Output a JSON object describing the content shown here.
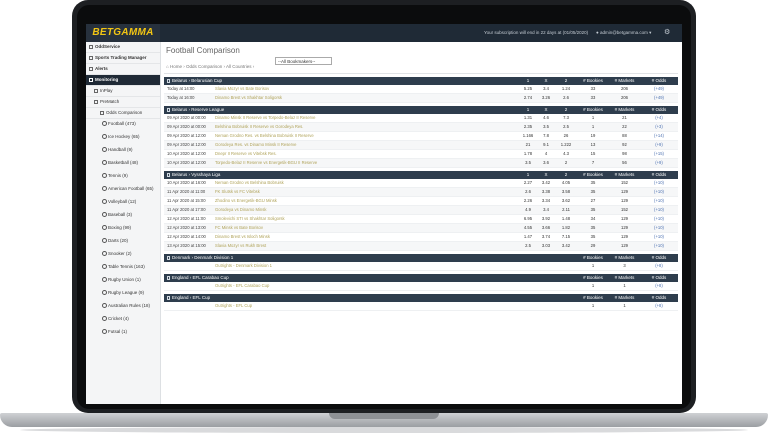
{
  "app": {
    "logo": "BETGAMMA",
    "subscription_note": "Your subscription will end in 22 days at (01/05/2020)",
    "user_email": "admin@betgamma.com"
  },
  "sidebar": {
    "items": [
      {
        "label": "OddService"
      },
      {
        "label": "Sports Trading Manager"
      },
      {
        "label": "Alerts"
      },
      {
        "label": "Monitoring"
      },
      {
        "label": "InPlay"
      },
      {
        "label": "PreMatch"
      },
      {
        "label": "Odds Comparison"
      }
    ],
    "sports": [
      {
        "label": "Football (473)"
      },
      {
        "label": "Ice Hockey (65)"
      },
      {
        "label": "Handball (9)"
      },
      {
        "label": "Basketball (48)"
      },
      {
        "label": "Tennis (9)"
      },
      {
        "label": "American Football (65)"
      },
      {
        "label": "Volleyball (12)"
      },
      {
        "label": "Baseball (3)"
      },
      {
        "label": "Boxing (99)"
      },
      {
        "label": "Darts (20)"
      },
      {
        "label": "Snooker (2)"
      },
      {
        "label": "Table Tennis (163)"
      },
      {
        "label": "Rugby Union (1)"
      },
      {
        "label": "Rugby League (9)"
      },
      {
        "label": "Australian Rules (18)"
      },
      {
        "label": "Cricket (4)"
      },
      {
        "label": "Futsal (1)"
      }
    ]
  },
  "page": {
    "title": "Football Comparison",
    "breadcrumb": "Home  ›  Odds Comparison  ›  All Countries  ›",
    "bookmaker_select": "--All Bookmakers--"
  },
  "columns": {
    "c1": "1",
    "cx": "X",
    "c2": "2",
    "bookies": "# Bookies",
    "markets": "# Markets",
    "odds": "# Odds"
  },
  "sections": [
    {
      "title": "Belarus › Belarusian Cup",
      "show_123": true,
      "rows": [
        {
          "date": "Today at 14:00",
          "match": "Slavia Mozyr vs Bate Borisov",
          "o1": "5.25",
          "ox": "3.4",
          "o2": "1.24",
          "bookies": "33",
          "markets": "206",
          "odds": "(+49)"
        },
        {
          "date": "Today at 16:00",
          "match": "Dinamo Brest vs Shakhtar Soligorsk",
          "o1": "2.74",
          "ox": "3.26",
          "o2": "2.6",
          "bookies": "33",
          "markets": "206",
          "odds": "(+49)"
        }
      ]
    },
    {
      "title": "Belarus › Reserve League",
      "show_123": true,
      "rows": [
        {
          "date": "09 Apr 2020 at 00:00",
          "match": "Dinamo Minsk II Reserve vs Torpedo-Belaz II Reserve",
          "o1": "1.31",
          "ox": "4.6",
          "o2": "7.3",
          "bookies": "1",
          "markets": "21",
          "odds": "(+4)"
        },
        {
          "date": "09 Apr 2020 at 00:00",
          "match": "Belshina Bobruisk II Reserve vs Gorodeya Res.",
          "o1": "2.35",
          "ox": "3.5",
          "o2": "2.5",
          "bookies": "1",
          "markets": "22",
          "odds": "(+3)"
        },
        {
          "date": "09 Apr 2020 at 12:00",
          "match": "Neman Grodno Res. vs Belshina Bobruisk II Reserve",
          "o1": "1.166",
          "ox": "7.8",
          "o2": "26",
          "bookies": "19",
          "markets": "88",
          "odds": "(+14)"
        },
        {
          "date": "09 Apr 2020 at 12:00",
          "match": "Gorodeya Res. vs Dinamo Minsk II Reserve",
          "o1": "21",
          "ox": "9.1",
          "o2": "1.222",
          "bookies": "13",
          "markets": "92",
          "odds": "(+9)"
        },
        {
          "date": "10 Apr 2020 at 12:00",
          "match": "Dnepr II Reserve vs Vitebsk Res.",
          "o1": "1.78",
          "ox": "4",
          "o2": "4.3",
          "bookies": "15",
          "markets": "98",
          "odds": "(+15)"
        },
        {
          "date": "10 Apr 2020 at 12:00",
          "match": "Torpedo-Belaz II Reserve vs Energetik-BGU II Reserve",
          "o1": "3.5",
          "ox": "3.6",
          "o2": "2",
          "bookies": "7",
          "markets": "56",
          "odds": "(+9)"
        }
      ]
    },
    {
      "title": "Belarus › Vysshaya Liga",
      "show_123": true,
      "rows": [
        {
          "date": "10 Apr 2020 at 16:00",
          "match": "Neman Grodno vs Belshina Bobruisk",
          "o1": "2.27",
          "ox": "3.42",
          "o2": "4.05",
          "bookies": "35",
          "markets": "152",
          "odds": "(+10)"
        },
        {
          "date": "11 Apr 2020 at 11:00",
          "match": "FK Slutsk vs FC Vitebsk",
          "o1": "2.6",
          "ox": "3.38",
          "o2": "3.58",
          "bookies": "35",
          "markets": "129",
          "odds": "(+10)"
        },
        {
          "date": "11 Apr 2020 at 15:00",
          "match": "Zhodino vs Energetik-BGU Minsk",
          "o1": "2.26",
          "ox": "3.34",
          "o2": "3.62",
          "bookies": "27",
          "markets": "129",
          "odds": "(+10)"
        },
        {
          "date": "11 Apr 2020 at 17:00",
          "match": "Gorodeya vs Dinamo Minsk",
          "o1": "4.9",
          "ox": "3.4",
          "o2": "2.11",
          "bookies": "35",
          "markets": "152",
          "odds": "(+10)"
        },
        {
          "date": "12 Apr 2020 at 11:00",
          "match": "Smolevichi STI vs Shakhtar Soligorsk",
          "o1": "6.95",
          "ox": "3.92",
          "o2": "1.48",
          "bookies": "34",
          "markets": "129",
          "odds": "(+10)"
        },
        {
          "date": "12 Apr 2020 at 13:00",
          "match": "FC Minsk vs Bate Borisov",
          "o1": "4.55",
          "ox": "3.66",
          "o2": "1.82",
          "bookies": "35",
          "markets": "129",
          "odds": "(+10)"
        },
        {
          "date": "12 Apr 2020 at 14:00",
          "match": "Dinamo Brest vs Isloch Minsk",
          "o1": "1.47",
          "ox": "3.74",
          "o2": "7.15",
          "bookies": "35",
          "markets": "129",
          "odds": "(+10)"
        },
        {
          "date": "13 Apr 2020 at 15:00",
          "match": "Slavia Mozyr vs Rukh Brest",
          "o1": "2.5",
          "ox": "3.03",
          "o2": "3.42",
          "bookies": "29",
          "markets": "129",
          "odds": "(+10)"
        }
      ]
    },
    {
      "title": "Denmark › Denmark Division 1",
      "show_123": false,
      "rows": [
        {
          "date": "",
          "match": "Outrights - Denmark Division 1",
          "o1": "",
          "ox": "",
          "o2": "",
          "bookies": "1",
          "markets": "3",
          "odds": "(+8)"
        }
      ]
    },
    {
      "title": "England › EFL Carabao Cup",
      "show_123": false,
      "rows": [
        {
          "date": "",
          "match": "Outrights - EFL Carabao Cup",
          "o1": "",
          "ox": "",
          "o2": "",
          "bookies": "1",
          "markets": "1",
          "odds": "(+8)"
        }
      ]
    },
    {
      "title": "England › EFL Cup",
      "show_123": false,
      "rows": [
        {
          "date": "",
          "match": "Outrights - EFL Cup",
          "o1": "",
          "ox": "",
          "o2": "",
          "bookies": "1",
          "markets": "1",
          "odds": "(+8)"
        }
      ]
    }
  ]
}
